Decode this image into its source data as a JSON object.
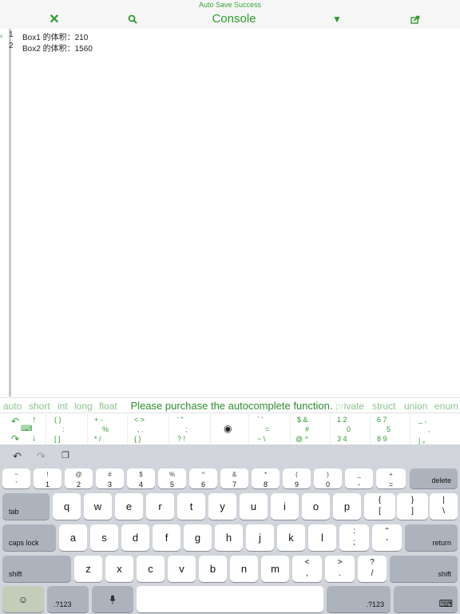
{
  "header": {
    "save_status": "Auto Save Success",
    "title": "Console"
  },
  "editor": {
    "lines": [
      {
        "number": "1",
        "text": "Box1 的体积：210"
      },
      {
        "number": "2",
        "text": "Box2 的体积：1560"
      }
    ]
  },
  "keyword_bar": {
    "keywords": [
      "auto",
      "short",
      "int",
      "long",
      "float",
      "private",
      "struct",
      "union",
      "enum"
    ],
    "message": "Please purchase the autocomplete function."
  },
  "symbol_bar": {
    "cells": [
      {
        "glyphs": [
          "( )",
          ":",
          "[ ]"
        ]
      },
      {
        "glyphs": [
          "+ -",
          "%",
          "* /"
        ]
      },
      {
        "glyphs": [
          "< >",
          ",  .",
          "{ }"
        ]
      },
      {
        "glyphs": [
          "' \"",
          ";",
          "? !"
        ]
      },
      {
        "glyphs": [
          "` '",
          "=",
          "~ \\"
        ]
      },
      {
        "glyphs": [
          "$ &",
          "#",
          "@ ^"
        ]
      },
      {
        "glyphs": [
          "1 2",
          "0",
          "3 4"
        ]
      },
      {
        "glyphs": [
          "6 7",
          "5",
          "8 9"
        ]
      },
      {
        "glyphs": [
          "_ ,",
          ",",
          "| 。"
        ]
      }
    ]
  },
  "keyboard": {
    "number_row": [
      {
        "top": "~",
        "bottom": "`"
      },
      {
        "top": "!",
        "bottom": "1"
      },
      {
        "top": "@",
        "bottom": "2"
      },
      {
        "top": "#",
        "bottom": "3"
      },
      {
        "top": "$",
        "bottom": "4"
      },
      {
        "top": "%",
        "bottom": "5"
      },
      {
        "top": "^",
        "bottom": "6"
      },
      {
        "top": "&",
        "bottom": "7"
      },
      {
        "top": "*",
        "bottom": "8"
      },
      {
        "top": "(",
        "bottom": "9"
      },
      {
        "top": ")",
        "bottom": "0"
      },
      {
        "top": "_",
        "bottom": "-"
      },
      {
        "top": "+",
        "bottom": "="
      }
    ],
    "delete_label": "delete",
    "tab_label": "tab",
    "row_q": [
      "q",
      "w",
      "e",
      "r",
      "t",
      "y",
      "u",
      "i",
      "o",
      "p"
    ],
    "row_q_extra": [
      {
        "top": "{",
        "bottom": "["
      },
      {
        "top": "}",
        "bottom": "]"
      },
      {
        "top": "|",
        "bottom": "\\"
      }
    ],
    "caps_label": "caps lock",
    "row_a": [
      "a",
      "s",
      "d",
      "f",
      "g",
      "h",
      "j",
      "k",
      "l"
    ],
    "row_a_extra": [
      {
        "top": ":",
        "bottom": ";"
      },
      {
        "top": "\"",
        "bottom": "'"
      }
    ],
    "return_label": "return",
    "shift_label": "shift",
    "row_z": [
      "z",
      "x",
      "c",
      "v",
      "b",
      "n",
      "m"
    ],
    "row_z_extra": [
      {
        "top": "<",
        "bottom": ","
      },
      {
        "top": ">",
        "bottom": "."
      },
      {
        "top": "?",
        "bottom": "/"
      }
    ],
    "numbers_label": ".?123"
  }
}
